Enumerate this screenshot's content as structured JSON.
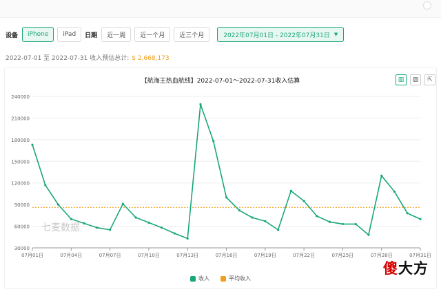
{
  "filters": {
    "device_label": "设备",
    "devices": [
      "iPhone",
      "iPad"
    ],
    "date_label": "日期",
    "ranges": [
      "近一周",
      "近一个月",
      "近三个月"
    ],
    "date_range": "2022年07月01日 - 2022年07月31日"
  },
  "summary": {
    "text": "2022-07-01 至 2022-07-31 收入预估总计:",
    "amount": "$ 2,668,173"
  },
  "chart_data": {
    "type": "line",
    "title": "【航海王热血航线】2022-07-01～2022-07-31收入估算",
    "x": [
      "07月01日",
      "07月02日",
      "07月03日",
      "07月04日",
      "07月05日",
      "07月06日",
      "07月07日",
      "07月08日",
      "07月09日",
      "07月10日",
      "07月11日",
      "07月12日",
      "07月13日",
      "07月14日",
      "07月15日",
      "07月16日",
      "07月17日",
      "07月18日",
      "07月19日",
      "07月20日",
      "07月21日",
      "07月22日",
      "07月23日",
      "07月24日",
      "07月25日",
      "07月26日",
      "07月27日",
      "07月28日",
      "07月29日",
      "07月30日",
      "07月31日"
    ],
    "x_tick_labels": [
      "07月01日",
      "07月04日",
      "07月07日",
      "07月10日",
      "07月13日",
      "07月16日",
      "07月19日",
      "07月22日",
      "07月25日",
      "07月28日",
      "07月31日"
    ],
    "series": [
      {
        "name": "收入",
        "color": "#19a67a",
        "values": [
          173000,
          117000,
          90000,
          70000,
          64000,
          58000,
          55000,
          91000,
          72000,
          65000,
          58000,
          50000,
          43000,
          229000,
          178000,
          100000,
          82000,
          72000,
          67000,
          55000,
          109000,
          95000,
          74000,
          66000,
          63000,
          63000,
          48000,
          130000,
          108000,
          78000,
          70000
        ]
      },
      {
        "name": "平均收入",
        "color": "#f0a020",
        "values": [
          86070
        ]
      }
    ],
    "ylim": [
      30000,
      240000
    ],
    "yticks": [
      30000,
      60000,
      90000,
      120000,
      150000,
      180000,
      210000,
      240000
    ],
    "grid": true,
    "legend_position": "bottom-center"
  },
  "watermark": "七麦数据",
  "logo": {
    "red": "傻",
    "black": "大方"
  }
}
